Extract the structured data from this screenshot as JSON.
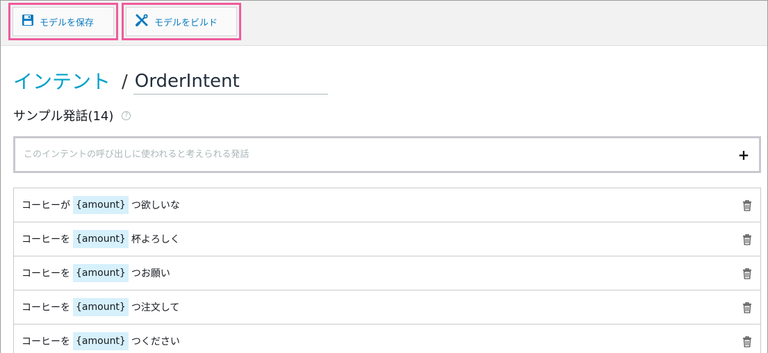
{
  "toolbar": {
    "save_label": "モデルを保存",
    "build_label": "モデルをビルド",
    "highlight_color": "#ef5b9c"
  },
  "header": {
    "breadcrumb": "インテント",
    "separator": "/",
    "intent_name": "OrderIntent"
  },
  "section": {
    "title": "サンプル発話(14)",
    "help_icon": "?"
  },
  "utterance_input": {
    "placeholder": "このインテントの呼び出しに使われると考えられる発話",
    "add_label": "+"
  },
  "utterances": [
    {
      "before": "コーヒーが",
      "slot": "{amount}",
      "after": "つ欲しいな"
    },
    {
      "before": "コーヒーを",
      "slot": "{amount}",
      "after": "杯よろしく"
    },
    {
      "before": "コーヒーを",
      "slot": "{amount}",
      "after": "つお願い"
    },
    {
      "before": "コーヒーを",
      "slot": "{amount}",
      "after": "つ注文して"
    },
    {
      "before": "コーヒーを",
      "slot": "{amount}",
      "after": "つください"
    }
  ],
  "colors": {
    "accent": "#00a1c9",
    "link": "#0a7bc1",
    "slot_bg": "#d6f0fc"
  }
}
